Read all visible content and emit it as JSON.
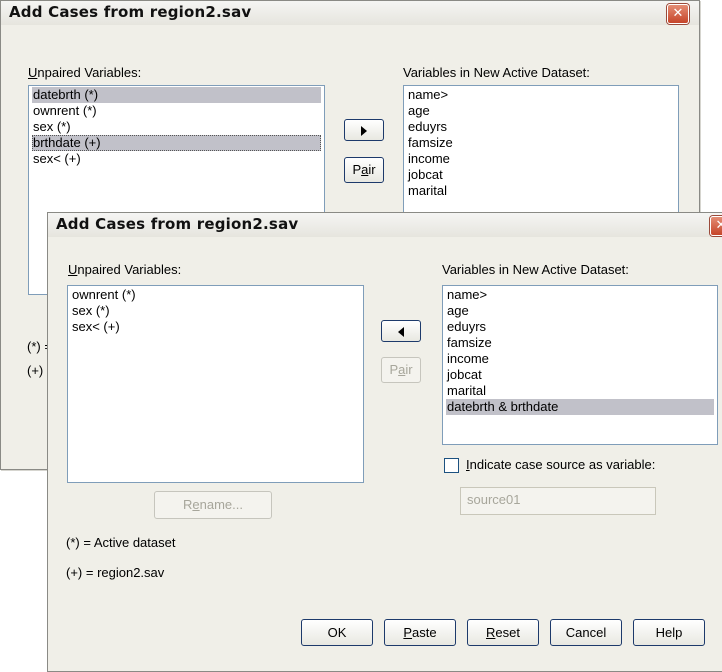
{
  "back_dialog": {
    "title": "Add Cases from region2.sav",
    "close_glyph": "✕",
    "unpaired_label_pre": "U",
    "unpaired_label_rest": "npaired Variables:",
    "unpaired_items": [
      "datebrth (*)",
      "ownrent (*)",
      "sex (*)",
      "brthdate (+)",
      "sex< (+)"
    ],
    "new_dataset_label": "Variables in New Active Dataset:",
    "new_dataset_items": [
      "name>",
      "age",
      "eduyrs",
      "famsize",
      "income",
      "jobcat",
      "marital"
    ],
    "pair_label_pre": "P",
    "pair_label_a": "a",
    "pair_label_rest": "ir",
    "legend_active_stub": "(*) =",
    "legend_region_stub": "(+)"
  },
  "front_dialog": {
    "title": "Add Cases from region2.sav",
    "close_glyph": "✕",
    "unpaired_label_pre": "U",
    "unpaired_label_rest": "npaired Variables:",
    "unpaired_items": [
      "ownrent (*)",
      "sex (*)",
      "sex< (+)"
    ],
    "new_dataset_label": "Variables in New Active Dataset:",
    "new_dataset_items": [
      "name>",
      "age",
      "eduyrs",
      "famsize",
      "income",
      "jobcat",
      "marital",
      "datebrth & brthdate"
    ],
    "pair_label_pre": "P",
    "pair_label_a": "a",
    "pair_label_rest": "ir",
    "rename_label_pre": "R",
    "rename_label_e": "e",
    "rename_label_rest": "name...",
    "indicate_pre": "I",
    "indicate_rest": "ndicate case source as variable:",
    "source_value": "source01",
    "legend_active": "(*) = Active dataset",
    "legend_region": "(+) = region2.sav",
    "buttons": {
      "ok": "OK",
      "paste_pre": "P",
      "paste_rest": "aste",
      "reset_pre": "R",
      "reset_rest": "eset",
      "cancel": "Cancel",
      "help": "Help"
    }
  }
}
